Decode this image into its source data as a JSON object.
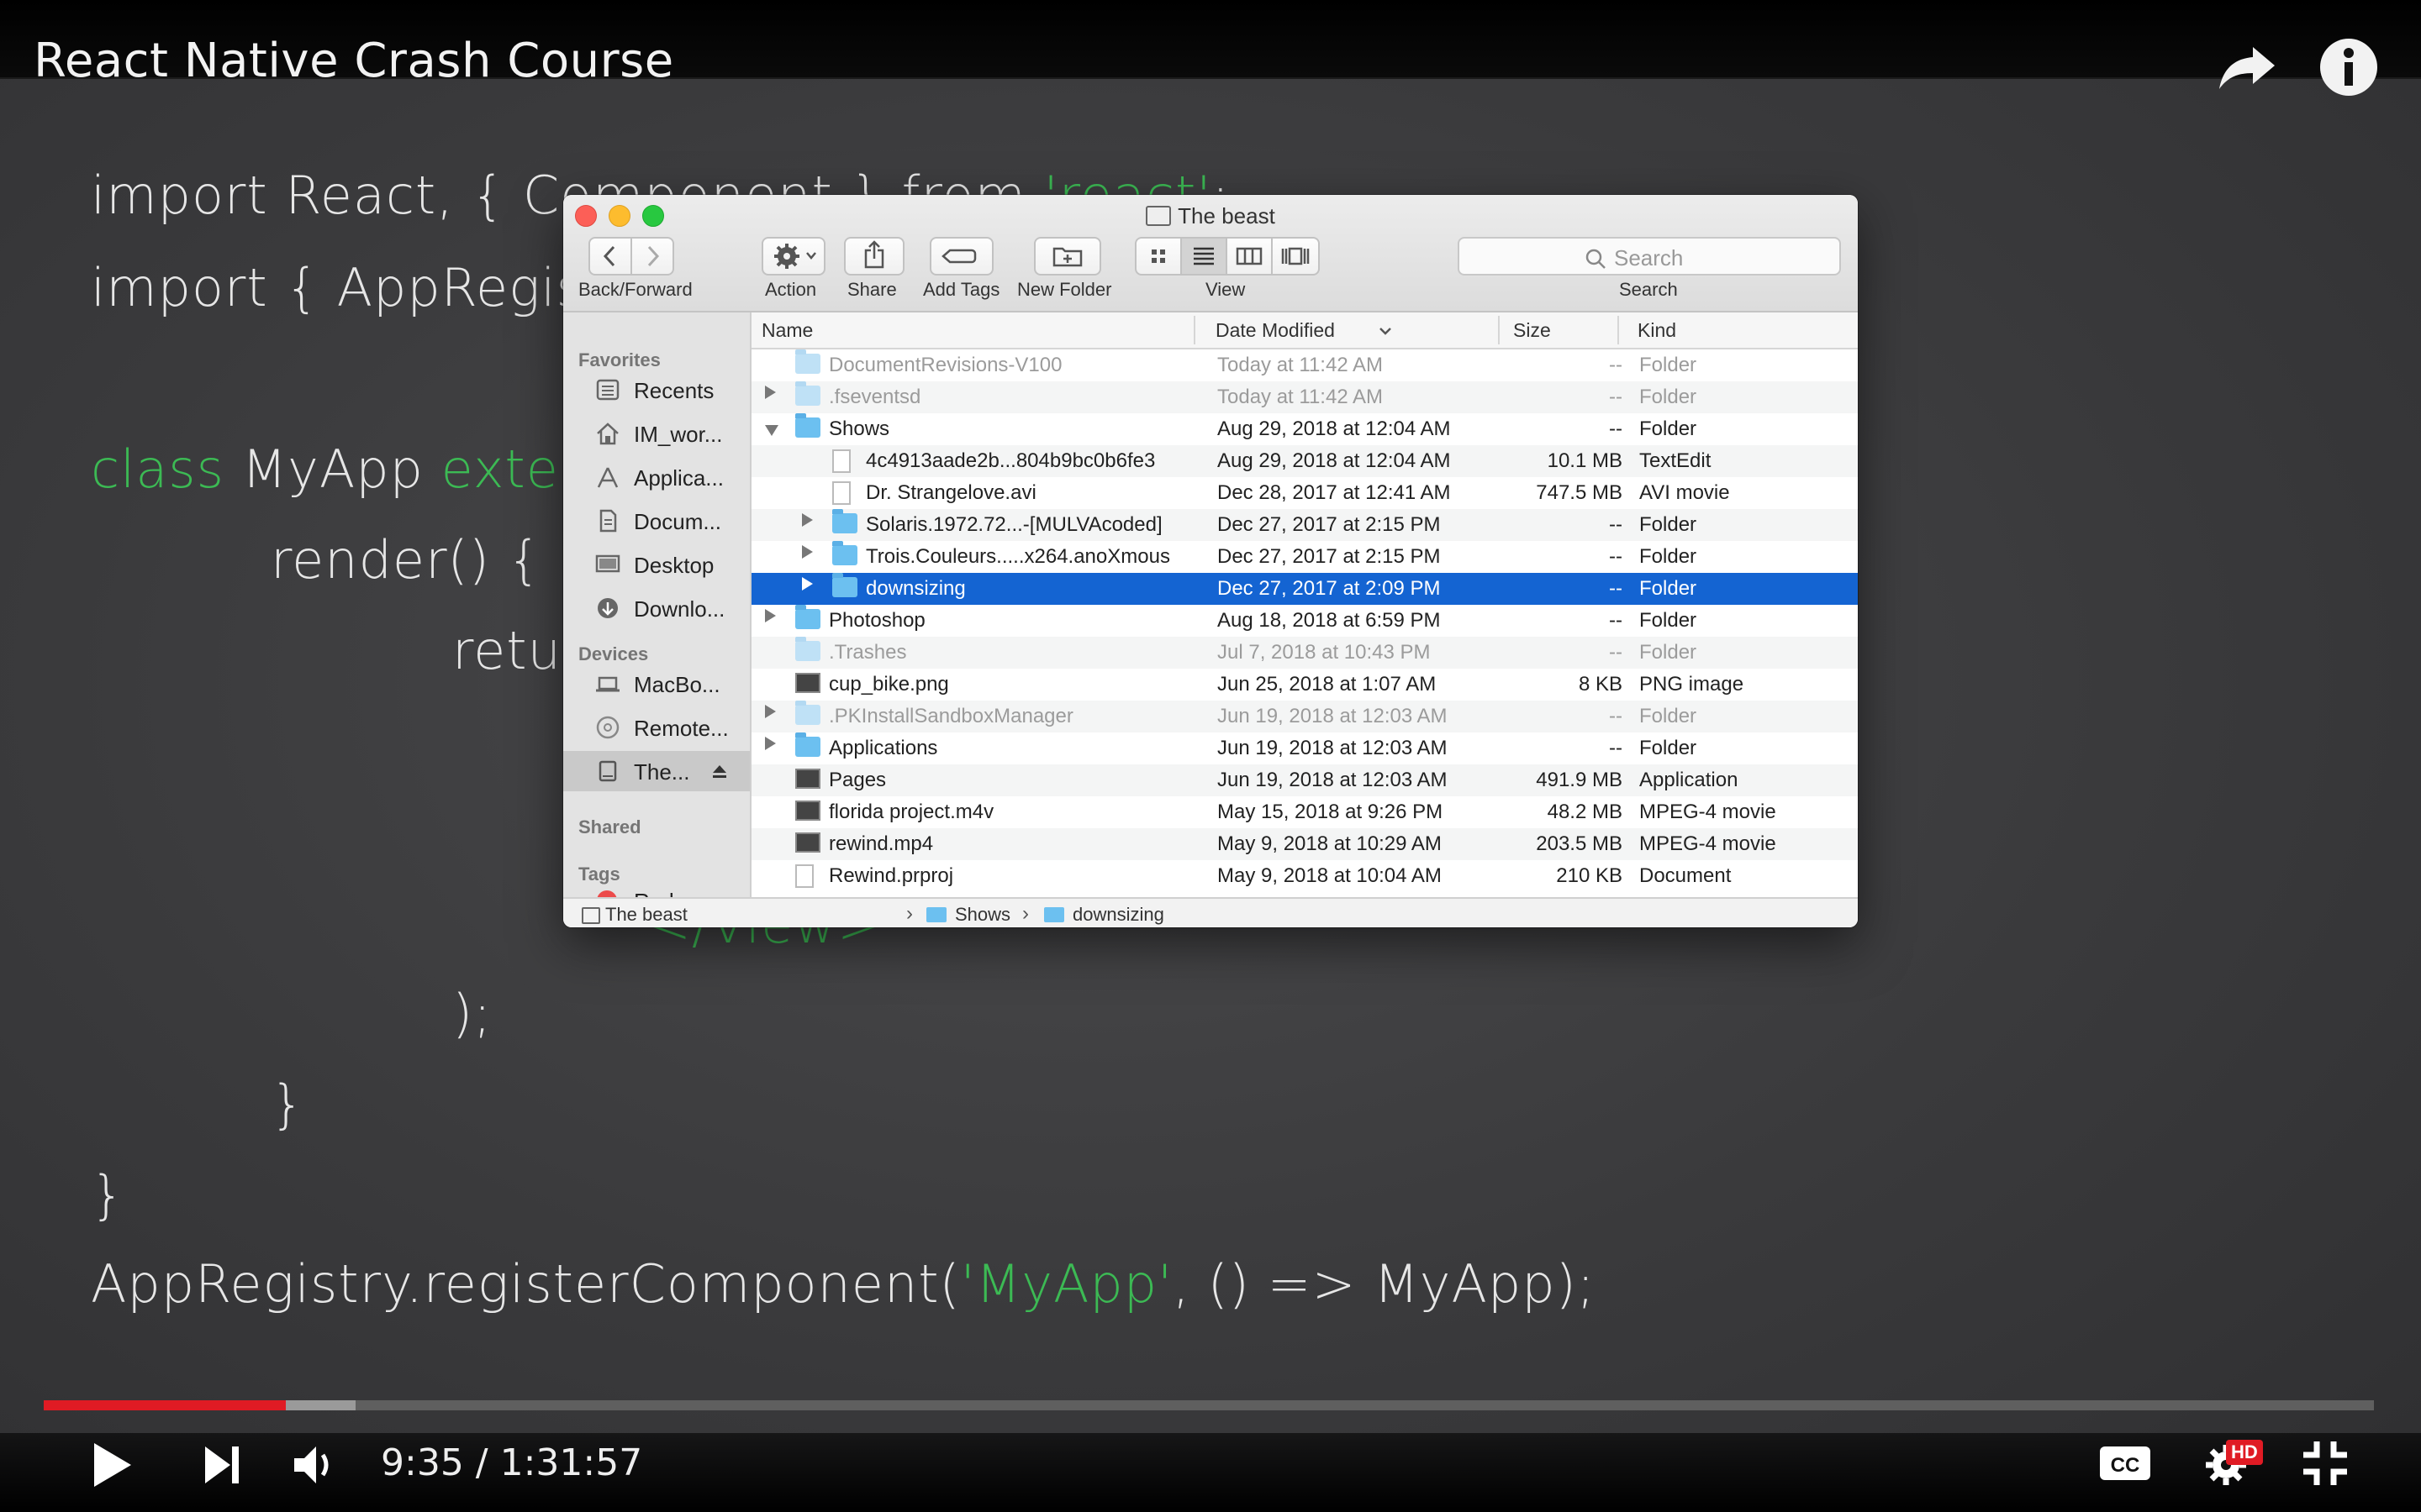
{
  "video": {
    "title": "React Native Crash Course",
    "time_display": "9:35 / 1:31:57",
    "progress_played": 0.104,
    "progress_buffered": 0.134,
    "quality_badge": "HD",
    "code_lines": [
      {
        "parts": [
          {
            "t": "import React, { Component } from ",
            "kw": false
          },
          {
            "t": "'react'",
            "kw": true
          },
          {
            "t": ";",
            "kw": false
          }
        ]
      },
      {
        "parts": [
          {
            "t": "import { AppRegistry",
            "kw": false
          }
        ]
      },
      {
        "parts": [
          {
            "t": "class",
            "kw": true
          },
          {
            "t": " MyApp ",
            "kw": false
          },
          {
            "t": "extends",
            "kw": true
          }
        ]
      },
      {
        "parts": [
          {
            "t": "render() {",
            "kw": false
          }
        ]
      },
      {
        "parts": [
          {
            "t": "return",
            "kw": false
          }
        ]
      },
      {
        "parts": [
          {
            "t": "</View>",
            "kw": true
          }
        ]
      },
      {
        "parts": [
          {
            "t": ");",
            "kw": false
          }
        ]
      },
      {
        "parts": [
          {
            "t": "}",
            "kw": false
          }
        ]
      },
      {
        "parts": [
          {
            "t": "}",
            "kw": false
          }
        ]
      },
      {
        "parts": [
          {
            "t": "AppRegistry.registerComponent(",
            "kw": false
          },
          {
            "t": "'MyApp'",
            "kw": true
          },
          {
            "t": ", () => MyApp);",
            "kw": false
          }
        ]
      }
    ]
  },
  "finder": {
    "window_title": "The beast",
    "toolbar": {
      "back_forward_label": "Back/Forward",
      "action_label": "Action",
      "share_label": "Share",
      "add_tags_label": "Add Tags",
      "new_folder_label": "New Folder",
      "view_label": "View",
      "search_label": "Search",
      "search_placeholder": "Search"
    },
    "sidebar": {
      "favorites_heading": "Favorites",
      "favorites": [
        "Recents",
        "IM_wor...",
        "Applica...",
        "Docum...",
        "Desktop",
        "Downlo..."
      ],
      "devices_heading": "Devices",
      "devices": [
        "MacBo...",
        "Remote...",
        "The..."
      ],
      "shared_heading": "Shared",
      "tags_heading": "Tags",
      "tags": [
        "Red"
      ],
      "tag_color": "#ec4b4b"
    },
    "columns": {
      "name": "Name",
      "date": "Date Modified",
      "size": "Size",
      "kind": "Kind"
    },
    "rows": [
      {
        "name": "DocumentRevisions-V100",
        "date": "Today at 11:42 AM",
        "size": "--",
        "kind": "Folder"
      },
      {
        "name": ".fseventsd",
        "date": "Today at 11:42 AM",
        "size": "--",
        "kind": "Folder"
      },
      {
        "name": "Shows",
        "date": "Aug 29, 2018 at 12:04 AM",
        "size": "--",
        "kind": "Folder"
      },
      {
        "name": "4c4913aade2b...804b9bc0b6fe3",
        "date": "Aug 29, 2018 at 12:04 AM",
        "size": "10.1 MB",
        "kind": "TextEdit"
      },
      {
        "name": "Dr. Strangelove.avi",
        "date": "Dec 28, 2017 at 12:41 AM",
        "size": "747.5 MB",
        "kind": "AVI movie"
      },
      {
        "name": "Solaris.1972.72...-[MULVAcoded]",
        "date": "Dec 27, 2017 at 2:15 PM",
        "size": "--",
        "kind": "Folder"
      },
      {
        "name": "Trois.Couleurs.....x264.anoXmous",
        "date": "Dec 27, 2017 at 2:15 PM",
        "size": "--",
        "kind": "Folder"
      },
      {
        "name": "downsizing",
        "date": "Dec 27, 2017 at 2:09 PM",
        "size": "--",
        "kind": "Folder"
      },
      {
        "name": "Photoshop",
        "date": "Aug 18, 2018 at 6:59 PM",
        "size": "--",
        "kind": "Folder"
      },
      {
        "name": ".Trashes",
        "date": "Jul 7, 2018 at 10:43 PM",
        "size": "--",
        "kind": "Folder"
      },
      {
        "name": "cup_bike.png",
        "date": "Jun 25, 2018 at 1:07 AM",
        "size": "8 KB",
        "kind": "PNG image"
      },
      {
        "name": ".PKInstallSandboxManager",
        "date": "Jun 19, 2018 at 12:03 AM",
        "size": "--",
        "kind": "Folder"
      },
      {
        "name": "Applications",
        "date": "Jun 19, 2018 at 12:03 AM",
        "size": "--",
        "kind": "Folder"
      },
      {
        "name": "Pages",
        "date": "Jun 19, 2018 at 12:03 AM",
        "size": "491.9 MB",
        "kind": "Application"
      },
      {
        "name": "florida project.m4v",
        "date": "May 15, 2018 at 9:26 PM",
        "size": "48.2 MB",
        "kind": "MPEG-4 movie"
      },
      {
        "name": "rewind.mp4",
        "date": "May 9, 2018 at 10:29 AM",
        "size": "203.5 MB",
        "kind": "MPEG-4 movie"
      },
      {
        "name": "Rewind.prproj",
        "date": "May 9, 2018 at 10:04 AM",
        "size": "210 KB",
        "kind": "Document"
      }
    ],
    "path_bar": [
      "The beast",
      "Shows",
      "downsizing"
    ],
    "selection_color": "#1464d2"
  }
}
